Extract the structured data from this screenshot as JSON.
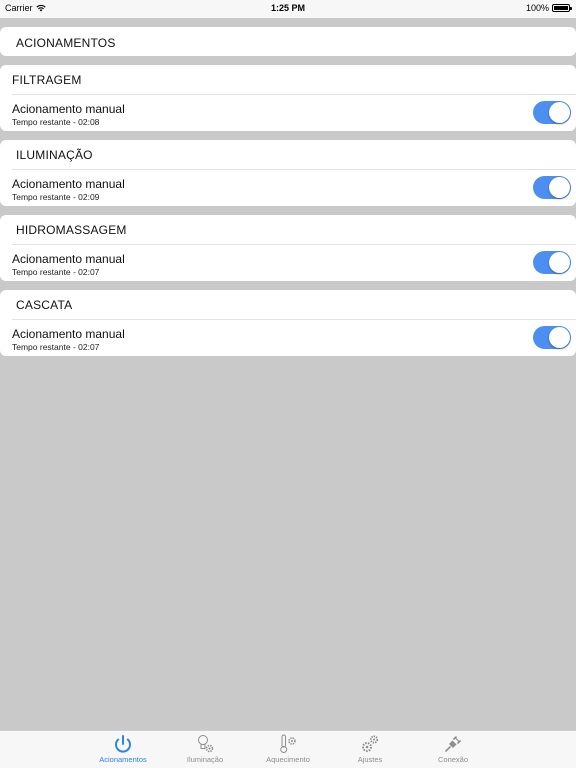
{
  "status_bar": {
    "carrier": "Carrier",
    "wifi_icon": "wifi-icon",
    "time": "1:25 PM",
    "battery_percent": "100%",
    "battery_level": 1.0
  },
  "header": {
    "title": "ACIONAMENTOS"
  },
  "sections": [
    {
      "title": "FILTRAGEM",
      "row_label": "Acionamento manual",
      "row_sub": "Tempo restante - 02:08",
      "toggle_on": true
    },
    {
      "title": "ILUMINAÇÃO",
      "row_label": "Acionamento manual",
      "row_sub": "Tempo restante - 02:09",
      "toggle_on": true
    },
    {
      "title": "HIDROMASSAGEM",
      "row_label": "Acionamento manual",
      "row_sub": "Tempo restante - 02:07",
      "toggle_on": true
    },
    {
      "title": "CASCATA",
      "row_label": "Acionamento manual",
      "row_sub": "Tempo restante - 02:07",
      "toggle_on": true
    }
  ],
  "tab_bar": {
    "accent_color": "#2f86e8",
    "inactive_color": "#8e8e8e",
    "tabs": [
      {
        "label": "Acionamentos",
        "icon": "power-icon",
        "active": true
      },
      {
        "label": "Iluminação",
        "icon": "bulb-gear-icon",
        "active": false
      },
      {
        "label": "Aquecimento",
        "icon": "thermometer-gear-icon",
        "active": false
      },
      {
        "label": "Ajustes",
        "icon": "gears-icon",
        "active": false
      },
      {
        "label": "Conexão",
        "icon": "plug-icon",
        "active": false
      }
    ]
  }
}
